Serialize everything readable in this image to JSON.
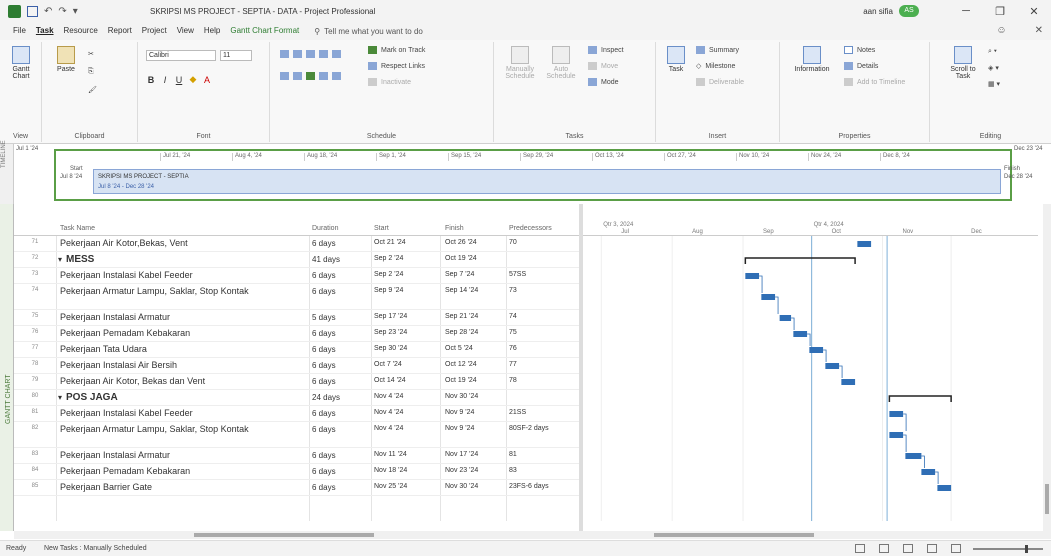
{
  "window": {
    "title": "SKRIPSI MS PROJECT - SEPTIA - DATA  -  Project Professional",
    "user": "aan sifia",
    "user_badge": "AS"
  },
  "menu": {
    "tabs": [
      "File",
      "Task",
      "Resource",
      "Report",
      "Project",
      "View",
      "Help",
      "Gantt Chart Format"
    ],
    "active": "Task",
    "tell_me": "Tell me what you want to do"
  },
  "ribbon": {
    "view": {
      "gantt_label": "Gantt Chart",
      "group": "View"
    },
    "clipboard": {
      "paste": "Paste",
      "group": "Clipboard"
    },
    "font": {
      "family": "Calibri",
      "size": "11",
      "group": "Font"
    },
    "schedule": {
      "mark_on_track": "Mark on Track",
      "respect_links": "Respect Links",
      "inactivate": "Inactivate",
      "group": "Schedule"
    },
    "tasks": {
      "manually": "Manually Schedule",
      "auto": "Auto Schedule",
      "inspect": "Inspect",
      "move": "Move",
      "mode": "Mode",
      "group": "Tasks"
    },
    "insert": {
      "task": "Task",
      "summary": "Summary",
      "milestone": "Milestone",
      "deliverable": "Deliverable",
      "group": "Insert"
    },
    "properties": {
      "information": "Information",
      "notes": "Notes",
      "details": "Details",
      "add_timeline": "Add to Timeline",
      "group": "Properties"
    },
    "editing": {
      "scroll": "Scroll to Task",
      "group": "Editing"
    }
  },
  "timeline": {
    "side_label": "TIMELINE",
    "left_date": "Jul 1 '24",
    "right_date": "Dec 23 '24",
    "start_label": "Start",
    "start_date": "Jul 8 '24",
    "finish_label": "Finish",
    "finish_date": "Dec 28 '24",
    "ticks": [
      "Jul 21, '24",
      "Aug 4, '24",
      "Aug 18, '24",
      "Sep 1, '24",
      "Sep 15, '24",
      "Sep 29, '24",
      "Oct 13, '24",
      "Oct 27, '24",
      "Nov 10, '24",
      "Nov 24, '24",
      "Dec 8, '24"
    ],
    "bar_title": "SKRIPSI MS PROJECT - SEPTIA",
    "bar_dates": "Jul 8 '24 - Dec 28 '24"
  },
  "gantt": {
    "side_label": "GANTT CHART",
    "headers": {
      "name": "Task Name",
      "duration": "Duration",
      "start": "Start",
      "finish": "Finish",
      "pred": "Predecessors"
    },
    "chart_header_top": [
      "Qtr 3, 2024",
      "Qtr 4, 2024"
    ],
    "chart_header_months": [
      "Jul",
      "Aug",
      "Sep",
      "Oct",
      "Nov",
      "Dec"
    ],
    "rows": [
      {
        "id": "71",
        "name": "Pekerjaan Air Kotor,Bekas, Vent",
        "duration": "6 days",
        "start": "Oct 21 '24",
        "finish": "Oct 26 '24",
        "pred": "70",
        "summary": false
      },
      {
        "id": "72",
        "name": "MESS",
        "duration": "41 days",
        "start": "Sep 2 '24",
        "finish": "Oct 19 '24",
        "pred": "",
        "summary": true
      },
      {
        "id": "73",
        "name": "Pekerjaan Instalasi Kabel Feeder",
        "duration": "6 days",
        "start": "Sep 2 '24",
        "finish": "Sep 7 '24",
        "pred": "57SS",
        "summary": false
      },
      {
        "id": "74",
        "name": "Pekerjaan Armatur Lampu, Saklar, Stop Kontak",
        "duration": "6 days",
        "start": "Sep 9 '24",
        "finish": "Sep 14 '24",
        "pred": "73",
        "summary": false
      },
      {
        "id": "75",
        "name": "Pekerjaan Instalasi Armatur",
        "duration": "5 days",
        "start": "Sep 17 '24",
        "finish": "Sep 21 '24",
        "pred": "74",
        "summary": false
      },
      {
        "id": "76",
        "name": "Pekerjaan Pemadam Kebakaran",
        "duration": "6 days",
        "start": "Sep 23 '24",
        "finish": "Sep 28 '24",
        "pred": "75",
        "summary": false
      },
      {
        "id": "77",
        "name": "Pekerjaan Tata Udara",
        "duration": "6 days",
        "start": "Sep 30 '24",
        "finish": "Oct 5 '24",
        "pred": "76",
        "summary": false
      },
      {
        "id": "78",
        "name": "Pekerjaan Instalasi Air Bersih",
        "duration": "6 days",
        "start": "Oct 7 '24",
        "finish": "Oct 12 '24",
        "pred": "77",
        "summary": false
      },
      {
        "id": "79",
        "name": "Pekerjaan Air Kotor, Bekas dan Vent",
        "duration": "6 days",
        "start": "Oct 14 '24",
        "finish": "Oct 19 '24",
        "pred": "78",
        "summary": false
      },
      {
        "id": "80",
        "name": "POS JAGA",
        "duration": "24 days",
        "start": "Nov 4 '24",
        "finish": "Nov 30 '24",
        "pred": "",
        "summary": true
      },
      {
        "id": "81",
        "name": "Pekerjaan Instalasi Kabel Feeder",
        "duration": "6 days",
        "start": "Nov 4 '24",
        "finish": "Nov 9 '24",
        "pred": "21SS",
        "summary": false
      },
      {
        "id": "82",
        "name": "Pekerjaan Armatur Lampu, Saklar, Stop Kontak",
        "duration": "6 days",
        "start": "Nov 4 '24",
        "finish": "Nov 9 '24",
        "pred": "80SF-2 days",
        "summary": false
      },
      {
        "id": "83",
        "name": "Pekerjaan Instalasi Armatur",
        "duration": "6 days",
        "start": "Nov 11 '24",
        "finish": "Nov 17 '24",
        "pred": "81",
        "summary": false
      },
      {
        "id": "84",
        "name": "Pekerjaan Pemadam Kebakaran",
        "duration": "6 days",
        "start": "Nov 18 '24",
        "finish": "Nov 23 '24",
        "pred": "83",
        "summary": false
      },
      {
        "id": "85",
        "name": "Pekerjaan Barrier Gate",
        "duration": "6 days",
        "start": "Nov 25 '24",
        "finish": "Nov 30 '24",
        "pred": "23FS-6 days",
        "summary": false
      }
    ]
  },
  "status": {
    "ready": "Ready",
    "new_tasks": "New Tasks : Manually Scheduled"
  },
  "colors": {
    "bar": "#2f6eb5",
    "timeline_border": "#5a9e46",
    "accent": "#2e7d32"
  }
}
